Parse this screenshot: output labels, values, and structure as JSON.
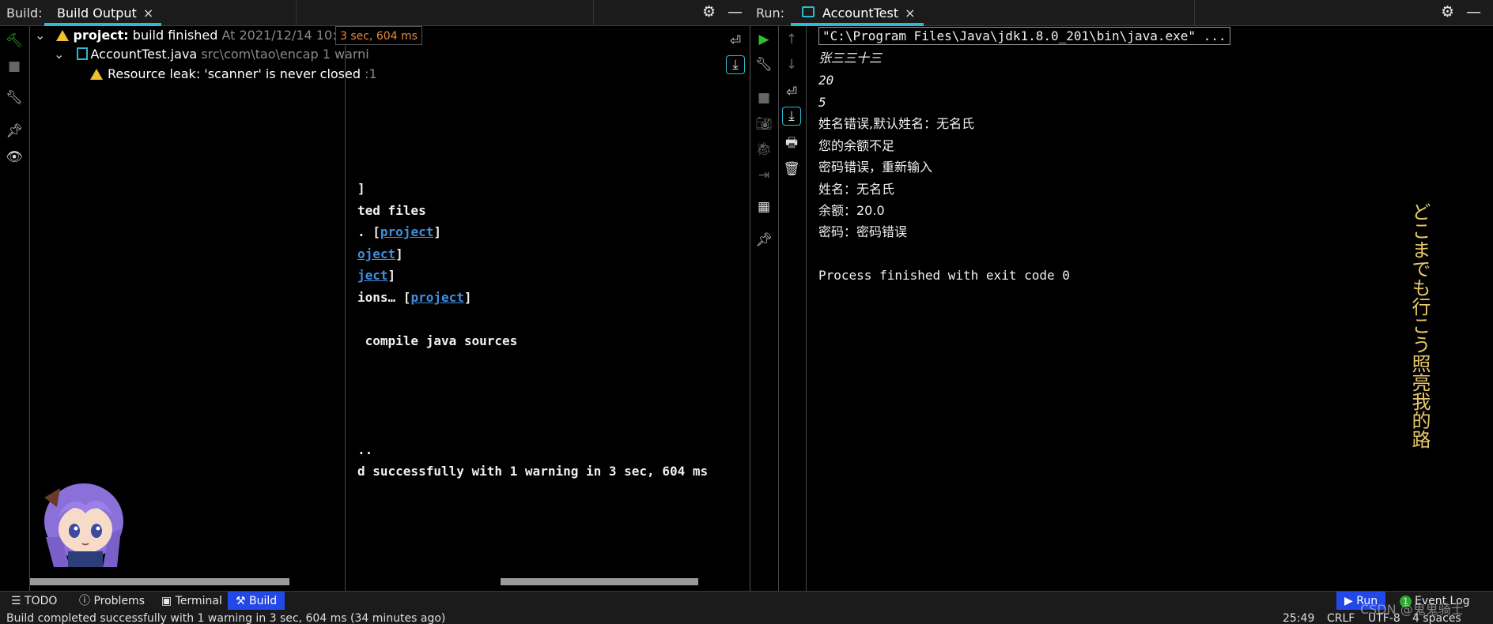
{
  "build_header": {
    "label": "Build:",
    "tab": "Build Output",
    "close": "×"
  },
  "run_header": {
    "label": "Run:",
    "tab": "AccountTest",
    "close": "×"
  },
  "build_tree": {
    "root_bold": "project:",
    "root_text": " build finished",
    "root_time": "At 2021/12/14 10:15 wi",
    "duration": "3 sec, 604 ms",
    "file_name": "AccountTest.java",
    "file_path": "src\\com\\tao\\encap 1 warni",
    "warning_text": "Resource leak: 'scanner' is never closed",
    "warning_suffix": ":1"
  },
  "build_console": {
    "l1": "]",
    "l2": "ted files",
    "l3_prefix": ". [",
    "l3_link": "project",
    "l3_suffix": "]",
    "l4_link": "oject",
    "l4_suffix": "]",
    "l5_link": "ject",
    "l5_suffix": "]",
    "l6_prefix": "ions… [",
    "l6_link": "project",
    "l6_suffix": "]",
    "l7": " compile java sources",
    "l8": "..",
    "l9": "d successfully with 1 warning in 3 sec, 604 ms"
  },
  "run_console": {
    "cmd": "\"C:\\Program Files\\Java\\jdk1.8.0_201\\bin\\java.exe\" ...",
    "in1": "张三三十三",
    "in2": "20",
    "in3": "5",
    "o1": "姓名错误,默认姓名：无名氏",
    "o2": "您的余额不足",
    "o3": "密码错误，重新输入",
    "o4": "姓名：无名氏",
    "o5": "余额：20.0",
    "o6": "密码：密码错误",
    "exit": "Process finished with exit code 0"
  },
  "decoration": {
    "col1": "どこまでも行こう",
    "col2": "照亮我的路"
  },
  "toolstrip": {
    "todo": "TODO",
    "problems": "Problems",
    "terminal": "Terminal",
    "build": "Build",
    "run": "Run",
    "event_log_count": "1",
    "event_log": "Event Log"
  },
  "statusbar": {
    "message": "Build completed successfully with 1 warning in 3 sec, 604 ms (34 minutes ago)",
    "position": "25:49",
    "line_sep": "CRLF",
    "encoding": "UTF-8",
    "indent": "4 spaces",
    "watermark": "CSDN @鬼鬼骑士"
  },
  "colors": {
    "accent": "#2bbcd0",
    "warning": "#f0c030",
    "link": "#3d8fe0",
    "input_green": "#4cae3e",
    "active_tab": "#2348e8"
  }
}
